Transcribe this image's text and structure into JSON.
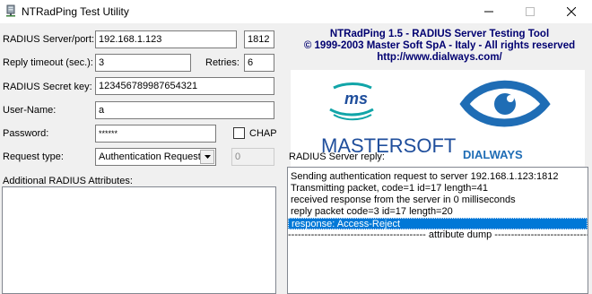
{
  "window": {
    "title": "NTRadPing Test Utility",
    "icons": {
      "app": "network-server-icon",
      "minimize": "minimize-icon",
      "maximize": "maximize-icon",
      "close": "close-icon"
    }
  },
  "header": {
    "line1": "NTRadPing 1.5 - RADIUS Server Testing Tool",
    "line2": "© 1999-2003 Master Soft SpA - Italy - All rights reserved",
    "line3": "http://www.dialways.com/"
  },
  "logos": {
    "mastersoft_text": "MASTERSOFT",
    "mastersoft_badge": "ms",
    "dialways_text": "DIALWAYS"
  },
  "form": {
    "server_label": "RADIUS Server/port:",
    "server_value": "192.168.1.123",
    "port_value": "1812",
    "timeout_label": "Reply timeout (sec.):",
    "timeout_value": "3",
    "retries_label": "Retries:",
    "retries_value": "6",
    "secret_label": "RADIUS Secret key:",
    "secret_value": "123456789987654321",
    "username_label": "User-Name:",
    "username_value": "a",
    "password_label": "Password:",
    "password_value": "******",
    "chap_label": "CHAP",
    "request_type_label": "Request type:",
    "request_type_value": "Authentication Request",
    "request_extra_value": "0",
    "attributes_label": "Additional RADIUS Attributes:"
  },
  "reply": {
    "label": "RADIUS Server reply:",
    "lines": [
      "Sending authentication request to server 192.168.1.123:1812",
      "Transmitting packet, code=1 id=17 length=41",
      "received response from the server in 0 milliseconds",
      "reply packet code=3 id=17 length=20",
      "response: Access-Reject",
      "------------------------------------------ attribute dump ------------------------------------------"
    ],
    "selected_index": 4
  },
  "colors": {
    "selection": "#0078d7",
    "header_text": "#000070",
    "mastersoft_blue": "#1f4e9c",
    "mastersoft_teal": "#11a5a8",
    "dialways_blue": "#1f6db5"
  }
}
